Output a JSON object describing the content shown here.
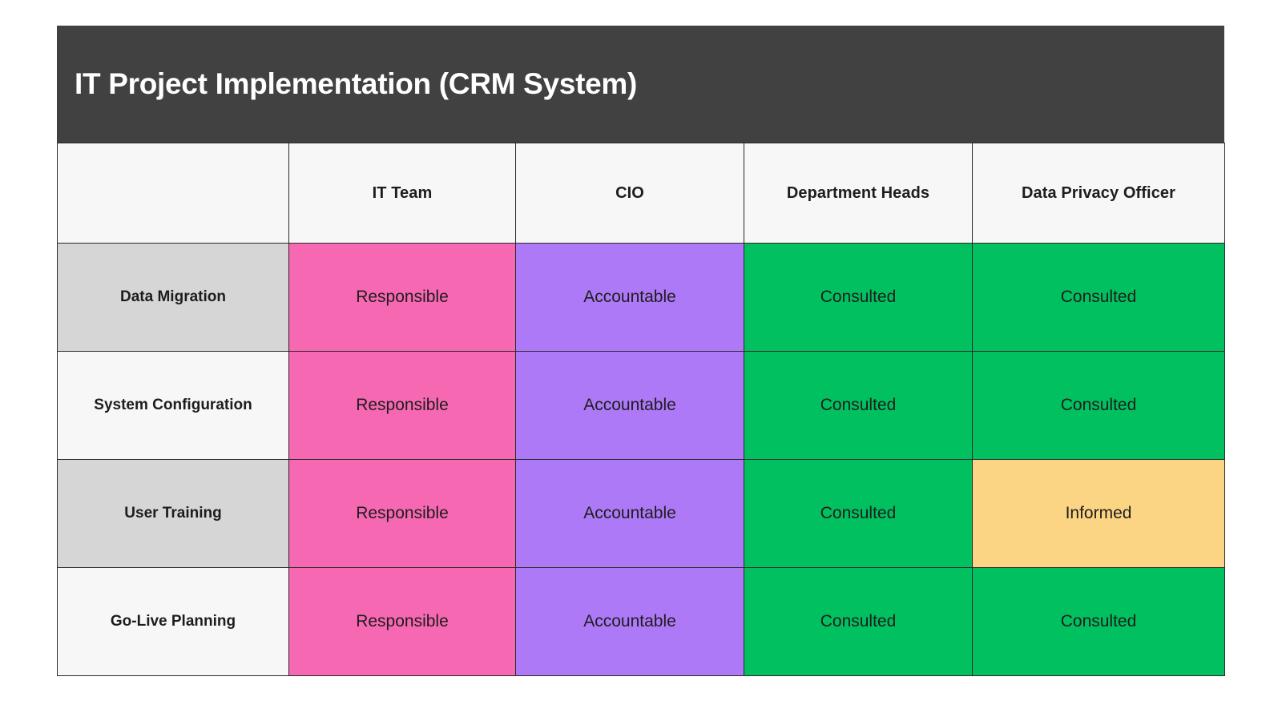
{
  "header": {
    "title": "IT Project Implementation (CRM System)",
    "background_color": "#414141",
    "text_color": "#ffffff"
  },
  "table": {
    "corner_label": "",
    "columns": [
      {
        "label": "IT Team"
      },
      {
        "label": "CIO"
      },
      {
        "label": "Department Heads"
      },
      {
        "label": "Data Privacy Officer"
      }
    ],
    "rows": [
      {
        "label": "Data Migration",
        "label_bg": "#d6d6d6",
        "cells": [
          {
            "value": "Responsible",
            "color": "#f768b3"
          },
          {
            "value": "Accountable",
            "color": "#ae79f7"
          },
          {
            "value": "Consulted",
            "color": "#00c060"
          },
          {
            "value": "Consulted",
            "color": "#00c060"
          }
        ]
      },
      {
        "label": "System Configuration",
        "label_bg": "#f7f7f7",
        "cells": [
          {
            "value": "Responsible",
            "color": "#f768b3"
          },
          {
            "value": "Accountable",
            "color": "#ae79f7"
          },
          {
            "value": "Consulted",
            "color": "#00c060"
          },
          {
            "value": "Consulted",
            "color": "#00c060"
          }
        ]
      },
      {
        "label": "User Training",
        "label_bg": "#d6d6d6",
        "cells": [
          {
            "value": "Responsible",
            "color": "#f768b3"
          },
          {
            "value": "Accountable",
            "color": "#ae79f7"
          },
          {
            "value": "Consulted",
            "color": "#00c060"
          },
          {
            "value": "Informed",
            "color": "#fbd583"
          }
        ]
      },
      {
        "label": "Go-Live Planning",
        "label_bg": "#f7f7f7",
        "cells": [
          {
            "value": "Responsible",
            "color": "#f768b3"
          },
          {
            "value": "Accountable",
            "color": "#ae79f7"
          },
          {
            "value": "Consulted",
            "color": "#00c060"
          },
          {
            "value": "Consulted",
            "color": "#00c060"
          }
        ]
      }
    ]
  },
  "palette": {
    "responsible": "#f768b3",
    "accountable": "#ae79f7",
    "consulted": "#00c060",
    "informed": "#fbd583",
    "row_label_alt": "#d6d6d6",
    "row_label_base": "#f7f7f7",
    "header_cell": "#f7f7f7",
    "border": "#2a2a2a",
    "title_bar": "#414141"
  }
}
